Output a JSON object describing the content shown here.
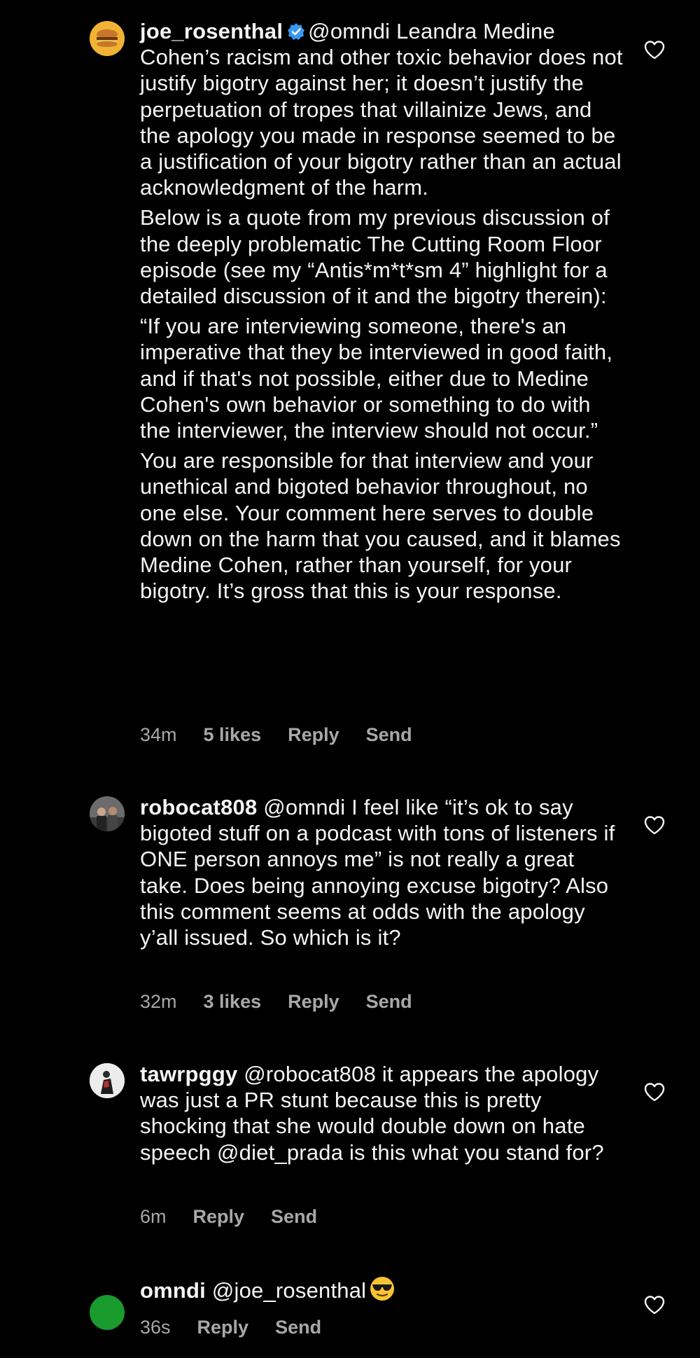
{
  "comments": [
    {
      "username": "joe_rosenthal",
      "verified": true,
      "paragraphs": [
        "@omndi Leandra Medine Cohen’s racism and other toxic behavior does not justify bigotry against her; it doesn’t justify the perpetuation of tropes that villainize Jews, and the apology you made in response seemed to be a justification of your bigotry rather than an actual acknowledgment of the harm.",
        "Below is a quote from my previous discussion of the deeply problematic The Cutting Room Floor episode (see my “Antis*m*t*sm 4” highlight for a detailed discussion of it and the bigotry therein):",
        "“If you are interviewing someone, there's an imperative that they be interviewed in good faith, and if that's not possible, either due to Medine Cohen's own behavior or something to do with the interviewer, the interview should not occur.”",
        "You are responsible for that interview and your unethical and bigoted behavior throughout, no one else. Your comment here serves to double down on the harm that you caused, and it blames Medine Cohen, rather than yourself, for your bigotry. It’s gross that this is your response."
      ],
      "time": "34m",
      "likes": "5 likes",
      "reply": "Reply",
      "send": "Send"
    },
    {
      "username": "robocat808",
      "text": "@omndi I feel like “it’s ok to say bigoted stuff on a podcast with tons of listeners if ONE person annoys me” is not really a great take. Does being annoying excuse bigotry? Also this comment seems at odds with the apology y’all issued. So which is it?",
      "time": "32m",
      "likes": "3 likes",
      "reply": "Reply",
      "send": "Send"
    },
    {
      "username": "tawrpggy",
      "text": "@robocat808 it appears the apology was just a PR stunt because this is pretty shocking that she would double down on hate speech @diet_prada is this what you stand for?",
      "time": "6m",
      "reply": "Reply",
      "send": "Send"
    },
    {
      "username": "omndi",
      "text": "@joe_rosenthal",
      "emoji": "sunglasses-emoji",
      "time": "36s",
      "reply": "Reply",
      "send": "Send"
    }
  ],
  "colors": {
    "background": "#000000",
    "text": "#f5f5f5",
    "meta": "#a8a8a8",
    "verified": "#3897f0",
    "omndi_avatar": "#1a9b2e"
  },
  "icons": [
    "verified-badge-icon",
    "heart-icon",
    "sunglasses-emoji"
  ]
}
